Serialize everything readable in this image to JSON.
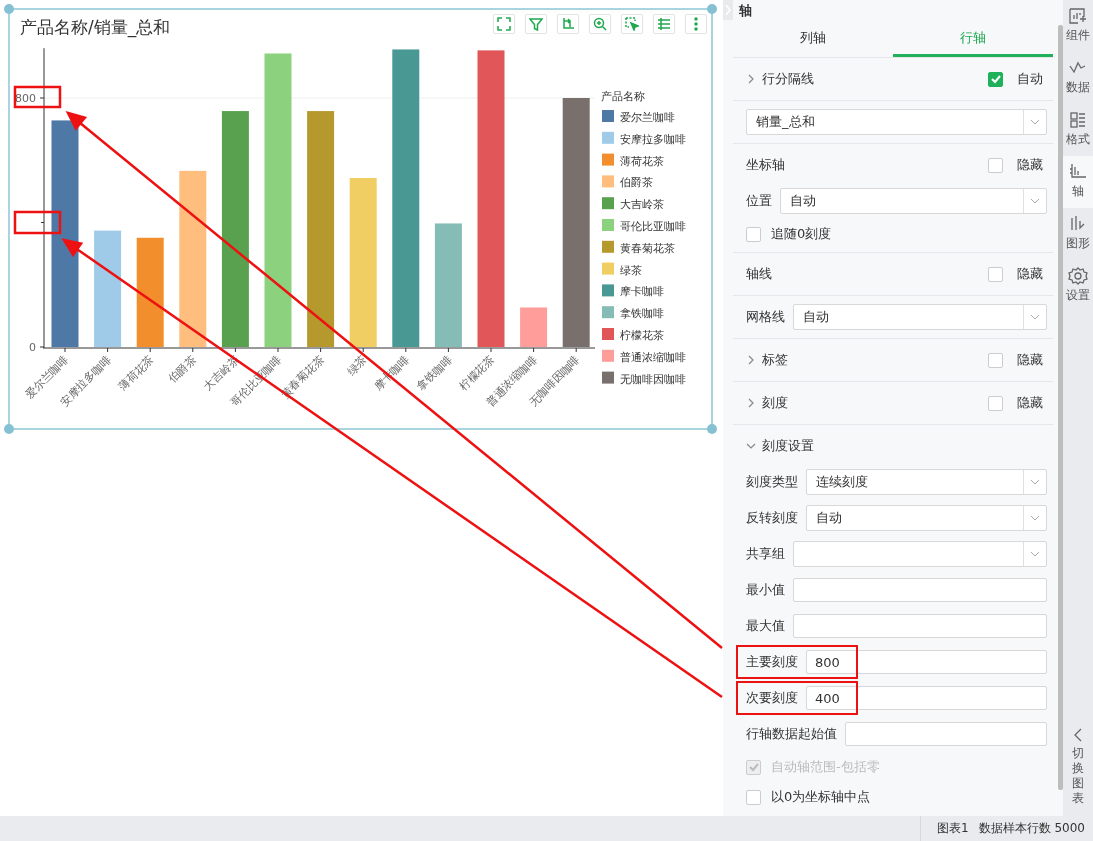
{
  "chart": {
    "title": "产品名称/销量_总和",
    "chart_data": {
      "type": "bar",
      "categories": [
        "爱尔兰咖啡",
        "安摩拉多咖啡",
        "薄荷花茶",
        "伯爵茶",
        "大吉岭茶",
        "哥伦比亚咖啡",
        "黄春菊花茶",
        "绿茶",
        "摩卡咖啡",
        "拿铁咖啡",
        "柠檬花茶",
        "普通浓缩咖啡",
        "无咖啡因咖啡"
      ],
      "values": [
        728,
        374,
        351,
        566,
        758,
        943,
        758,
        543,
        956,
        397,
        953,
        127,
        800
      ],
      "ylim": [
        0,
        960
      ],
      "yticks": [
        0,
        800
      ]
    },
    "legend": {
      "title": "产品名称",
      "items": [
        {
          "label": "爱尔兰咖啡",
          "color": "#4e79a7"
        },
        {
          "label": "安摩拉多咖啡",
          "color": "#a0cbe8"
        },
        {
          "label": "薄荷花茶",
          "color": "#f28e2b"
        },
        {
          "label": "伯爵茶",
          "color": "#ffbe7d"
        },
        {
          "label": "大吉岭茶",
          "color": "#59a14f"
        },
        {
          "label": "哥伦比亚咖啡",
          "color": "#8cd17d"
        },
        {
          "label": "黄春菊花茶",
          "color": "#b6992d"
        },
        {
          "label": "绿茶",
          "color": "#f1ce63"
        },
        {
          "label": "摩卡咖啡",
          "color": "#499894"
        },
        {
          "label": "拿铁咖啡",
          "color": "#86bcb6"
        },
        {
          "label": "柠檬花茶",
          "color": "#e15759"
        },
        {
          "label": "普通浓缩咖啡",
          "color": "#ff9d9a"
        },
        {
          "label": "无咖啡因咖啡",
          "color": "#79706e"
        }
      ]
    }
  },
  "panel": {
    "title": "轴",
    "tabs": [
      {
        "label": "列轴",
        "selected": false
      },
      {
        "label": "行轴",
        "selected": true
      }
    ],
    "groups": [
      {
        "rows": [
          {
            "kind": "collapsible",
            "label": "行分隔线",
            "expanded": false,
            "check": {
              "label": "自动",
              "checked": true
            }
          }
        ]
      },
      {
        "rows": [
          {
            "kind": "select",
            "value": "销量_总和"
          }
        ]
      },
      {
        "rows": [
          {
            "kind": "header",
            "label": "坐标轴",
            "check": {
              "label": "隐藏",
              "checked": false
            }
          },
          {
            "kind": "select",
            "label": "位置",
            "value": "自动"
          },
          {
            "kind": "checkbox",
            "label": "追随0刻度",
            "checked": false,
            "disabled": false
          }
        ]
      },
      {
        "rows": [
          {
            "kind": "header",
            "label": "轴线",
            "check": {
              "label": "隐藏",
              "checked": false
            }
          }
        ]
      },
      {
        "rows": [
          {
            "kind": "select",
            "label": "网格线",
            "value": "自动"
          }
        ]
      },
      {
        "rows": [
          {
            "kind": "collapsible",
            "label": "标签",
            "expanded": false,
            "check": {
              "label": "隐藏",
              "checked": false
            }
          }
        ]
      },
      {
        "rows": [
          {
            "kind": "collapsible",
            "label": "刻度",
            "expanded": false,
            "check": {
              "label": "隐藏",
              "checked": false
            }
          }
        ]
      },
      {
        "rows": [
          {
            "kind": "collapsible",
            "label": "刻度设置",
            "expanded": true
          },
          {
            "kind": "select",
            "label": "刻度类型",
            "value": "连续刻度"
          },
          {
            "kind": "select",
            "label": "反转刻度",
            "value": "自动"
          },
          {
            "kind": "select",
            "label": "共享组"
          },
          {
            "kind": "input",
            "label": "最小值"
          },
          {
            "kind": "input",
            "label": "最大值"
          },
          {
            "kind": "input",
            "label": "主要刻度",
            "value": "800",
            "highlighted": true
          },
          {
            "kind": "input",
            "label": "次要刻度",
            "value": "400",
            "highlighted": true
          },
          {
            "kind": "input",
            "label": "行轴数据起始值"
          },
          {
            "kind": "checkbox",
            "label": "自动轴范围-包括零",
            "checked": true,
            "disabled": true
          },
          {
            "kind": "checkbox",
            "label": "以0为坐标轴中点",
            "checked": false,
            "disabled": false
          }
        ]
      }
    ]
  },
  "rail": {
    "items": [
      {
        "label": "组件",
        "selected": false
      },
      {
        "label": "数据",
        "selected": false
      },
      {
        "label": "格式",
        "selected": false
      },
      {
        "label": "轴",
        "selected": true
      },
      {
        "label": "图形",
        "selected": false
      },
      {
        "label": "设置",
        "selected": false
      }
    ],
    "switch_label": "切换图表"
  },
  "status_bar": {
    "chart": "图表1",
    "rows": "数据样本行数 5000"
  }
}
